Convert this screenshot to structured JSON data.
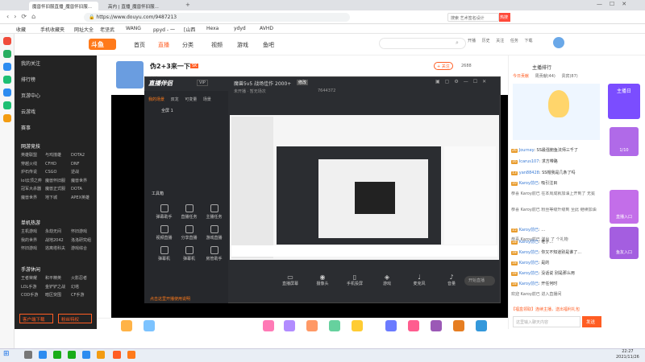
{
  "browser": {
    "tabs": [
      {
        "label": "魔兽怀旧服直播_魔兽怀旧服..."
      },
      {
        "label": "高内 | 直播_魔兽怀旧服..."
      }
    ],
    "url": "https://www.douyu.com/9487213",
    "search_placeholder": "搜索 艺术签名设计",
    "search_button": "热搜",
    "bookmarks": [
      "收藏",
      "手机收藏夹",
      "网址大全",
      "老坚武",
      "WANG",
      "ppyd - 一",
      "[山西",
      "Hexa",
      "ydyd",
      "AVHD"
    ]
  },
  "site": {
    "nav": [
      "首页",
      "直播",
      "分类",
      "视频",
      "游戏",
      "鱼吧"
    ],
    "actions": [
      "开播",
      "历史",
      "关注",
      "任务",
      "下载"
    ]
  },
  "sidebar": {
    "top_items": [
      "我的关注",
      "排行榜",
      "页游中心",
      "云游戏",
      "赛事"
    ],
    "sections": [
      {
        "title": "网游竞技",
        "items": [
          [
            "英雄联盟",
            "与鸡撞雄",
            "DOTA2"
          ],
          [
            "穿越火线",
            "CFHD",
            "DNF"
          ],
          [
            "炉石传说",
            "CSGO",
            "逆战"
          ],
          [
            "lol云顶之弈",
            "魔兽怀旧服",
            "魔兽世界"
          ],
          [
            "冠军大杀器",
            "魔兽正式服",
            "DOTA"
          ],
          [
            "魔兽世界",
            "地下城",
            "APEX英雄"
          ]
        ]
      },
      {
        "title": "单机热游",
        "items": [
          [
            "主机游戏",
            "永劫无间",
            "怀旧游戏"
          ],
          [
            "我的世界",
            "战地2042",
            "洛洛研究组"
          ],
          [
            "怀旧游戏",
            "逃离塔科夫",
            "游戏综合"
          ]
        ]
      },
      {
        "title": "手游休闲",
        "items": [
          [
            "王者荣耀",
            "和平精英",
            "火影忍者"
          ],
          [
            "LOL手游",
            "金铲铲之战",
            "幻塔"
          ],
          [
            "COD手游",
            "暗区突围",
            "CF手游"
          ]
        ]
      }
    ],
    "buttons": [
      "客户端下载",
      "粉丝特权"
    ]
  },
  "room": {
    "title": "伪2+3来一下",
    "follow": "+ 关注",
    "count": "2688",
    "tag": "SK",
    "host": "高道"
  },
  "obs": {
    "brand": "直播伴侣",
    "tab_labels": [
      "我的场景",
      "双龙",
      "可变量",
      "场景"
    ],
    "scene_item": "全屏 1",
    "stream_title": "魔兽5v5 战场佳作 2000+",
    "edit": "修改",
    "status_line": "未开播 · 暂无场次",
    "room_id": "7644372",
    "tools_label": "工具箱",
    "tools": [
      "弹幕助手",
      "直播任务",
      "主播任务",
      "视频直播",
      "分享直播",
      "游戏直播",
      "弹幕机",
      "弹幕机",
      "房管助手",
      "直播",
      "截图"
    ],
    "bottom_tip": "点击这里开播使用说明",
    "controls": [
      "直播屏幕",
      "摄像头",
      "手机投屏",
      "游戏",
      "麦克风",
      "音量"
    ],
    "start_button": "开始直播"
  },
  "chat": {
    "tabs": [
      "主播排行",
      "贵宾",
      "周榜"
    ],
    "sub_tabs": [
      "今日贡献",
      "周贡献(44)",
      "贵宾(87)"
    ],
    "lines": [
      {
        "badge": "26",
        "user": "Journey",
        "text": "SS最强鲍鱼法师三千了"
      },
      {
        "badge": "16",
        "user": "Icarus107",
        "text": "求方带路"
      },
      {
        "badge": "13",
        "user": "yan88428",
        "text": "SS帽我是几条了吗"
      },
      {
        "badge": "10",
        "user": "Karoy前已",
        "text": "吸引注目"
      },
      {
        "badge": "",
        "user": "恭喜 Karoy前已",
        "text": "在本周成就加油上开到了 无冕"
      },
      {
        "badge": "",
        "user": "恭喜 Karoy前已",
        "text": "粉丝等级升级到 至此 继续加油"
      },
      {
        "badge": "15",
        "user": "Karoy前已",
        "text": "…"
      },
      {
        "badge": "",
        "user": "恭喜 Karoy前已",
        "text": "送出 了 个礼物"
      },
      {
        "badge": "18",
        "user": "Karoy前已",
        "text": "老子…"
      },
      {
        "badge": "18",
        "user": "Karoy前已",
        "text": "你又不知道别是谁了…"
      },
      {
        "badge": "18",
        "user": "Karoy前已",
        "text": "是的"
      },
      {
        "badge": "18",
        "user": "Karoy前已",
        "text": "没话说 别是那么用"
      },
      {
        "badge": "18",
        "user": "Karoy前已",
        "text": "开任何时"
      },
      {
        "badge": "",
        "user": "欢迎 Karoy前已",
        "text": "进入直播间"
      }
    ],
    "footer_banner": "【福盒领取】连续主播，送出福利礼包",
    "input_placeholder": "这里输入聊天内容",
    "send": "发送"
  },
  "rail": {
    "labels": [
      "主播日",
      "1/10",
      "直播入口",
      "鱼友入口"
    ]
  },
  "taskbar": {
    "time": "22:27",
    "date": "2021/11/26"
  },
  "colors": {
    "douyu_orange": "#ff5d23",
    "sidebar_bg": "#232323",
    "obs_bg": "#2b2d31",
    "link_blue": "#3a7bd5"
  }
}
